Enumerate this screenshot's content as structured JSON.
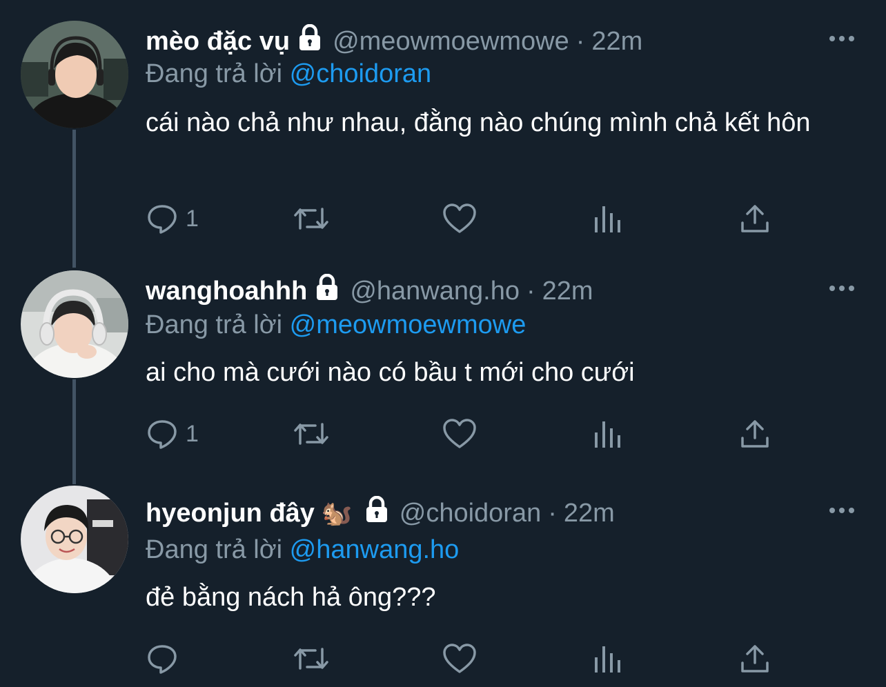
{
  "reply_prefix": "Đang trả lời",
  "colors": {
    "background": "#15202b",
    "text_primary": "#ffffff",
    "text_secondary": "#8899a6",
    "mention": "#1d9bf0",
    "thread_line": "#425364"
  },
  "tweets": [
    {
      "display_name": "mèo đặc vụ",
      "emoji": "",
      "protected_icon": "lock-icon",
      "handle": "@meowmoewmowe",
      "separator": "·",
      "time": "22m",
      "replying_to": "@choidoran",
      "text": "cái nào chả như nhau, đằng nào chúng mình chả kết hôn",
      "reply_count": "1",
      "actions": [
        "reply-icon",
        "retweet-icon",
        "like-icon",
        "analytics-icon",
        "share-icon"
      ],
      "more_icon": "more-icon"
    },
    {
      "display_name": "wanghoahhh",
      "emoji": "",
      "protected_icon": "lock-icon",
      "handle": "@hanwang.ho",
      "separator": "·",
      "time": "22m",
      "replying_to": "@meowmoewmowe",
      "text": "ai cho mà cưới nào có bầu t mới cho cưới",
      "reply_count": "1",
      "actions": [
        "reply-icon",
        "retweet-icon",
        "like-icon",
        "analytics-icon",
        "share-icon"
      ],
      "more_icon": "more-icon"
    },
    {
      "display_name": "hyeonjun đây",
      "emoji": "🐿️",
      "protected_icon": "lock-icon",
      "handle": "@choidoran",
      "separator": "·",
      "time": "22m",
      "replying_to": "@hanwang.ho",
      "text": "đẻ bằng nách hả ông???",
      "reply_count": "",
      "actions": [
        "reply-icon",
        "retweet-icon",
        "like-icon",
        "analytics-icon",
        "share-icon"
      ],
      "more_icon": "more-icon"
    }
  ]
}
